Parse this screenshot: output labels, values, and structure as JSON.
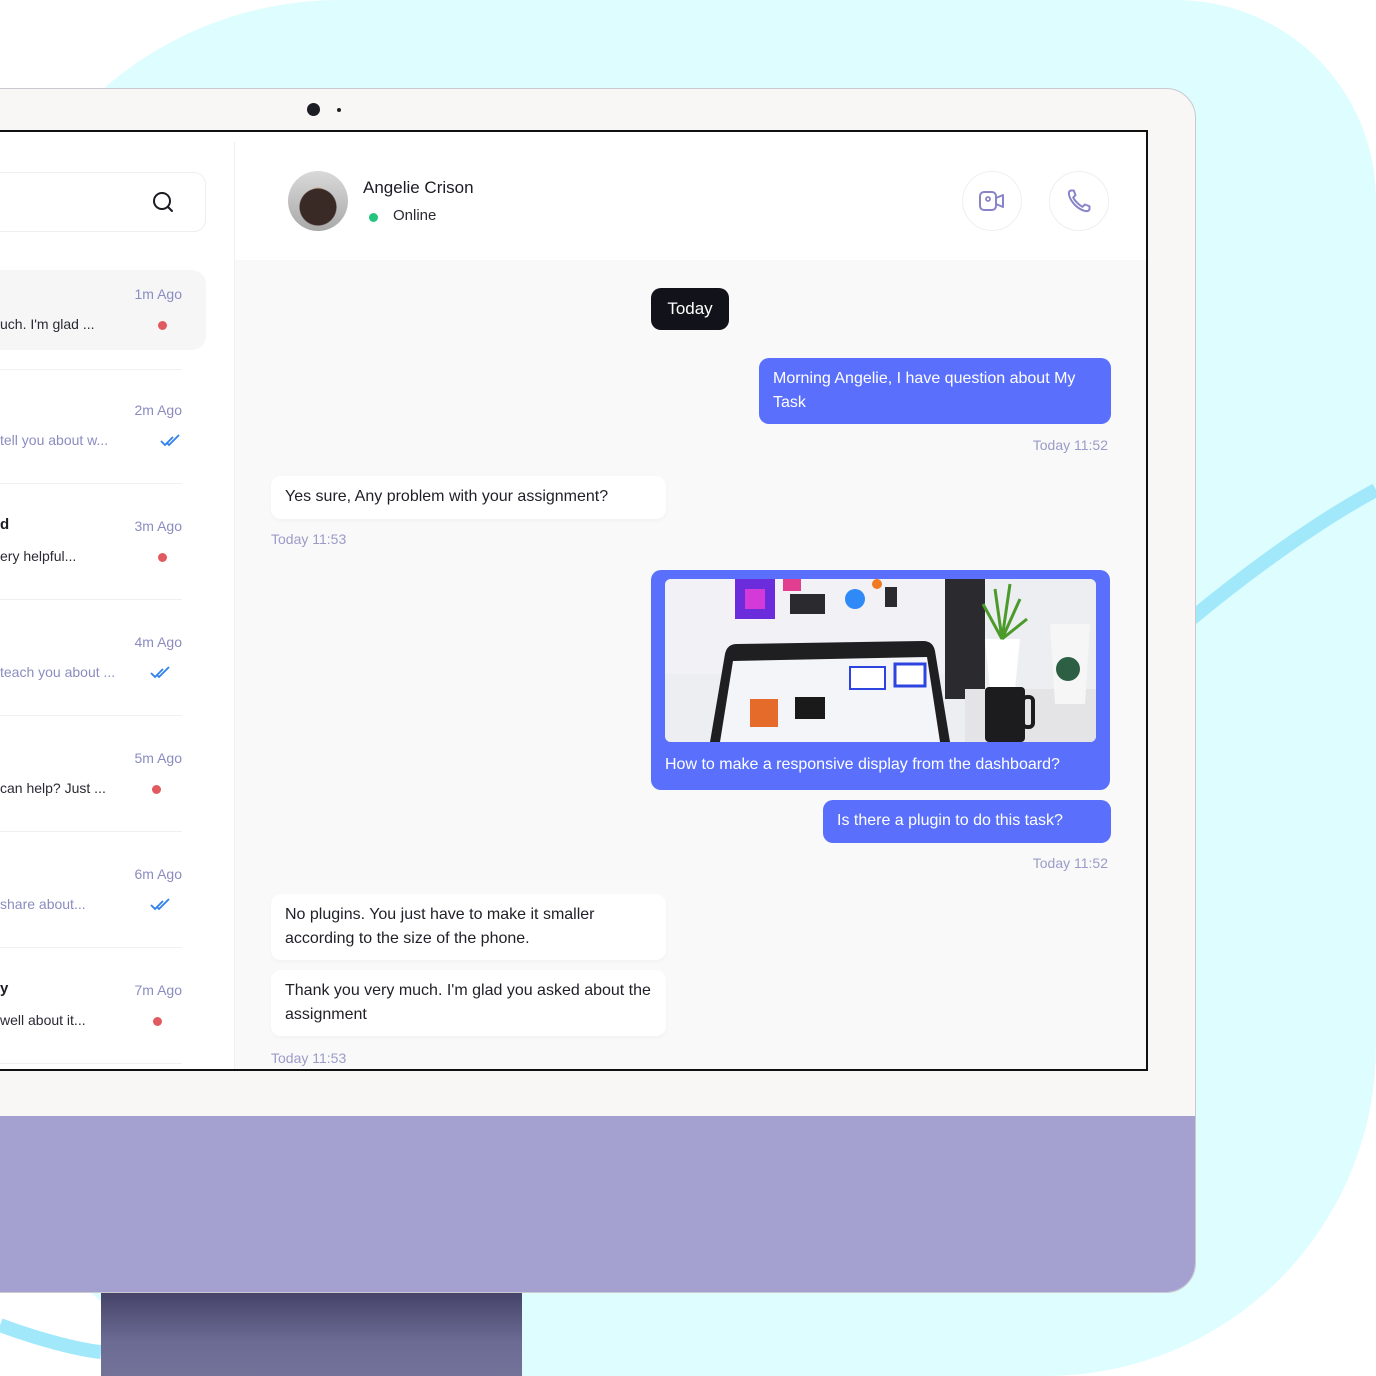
{
  "colors": {
    "accent": "#5a70fd",
    "background_tint": "#defdfe",
    "monitor_chin": "#a4a1d0",
    "online": "#22c47e",
    "unread": "#e05a5f",
    "read_check": "#2f80ed",
    "muted_text": "#8b8cc0"
  },
  "sidebar": {
    "search": {
      "placeholder": "",
      "icon": "search-icon"
    },
    "chats": [
      {
        "name": "",
        "preview": "uch. I'm glad ...",
        "time": "1m Ago",
        "status": "unread",
        "active": true
      },
      {
        "name": "",
        "preview": "tell you about w...",
        "time": "2m Ago",
        "status": "read"
      },
      {
        "name": "d",
        "preview": "ery helpful...",
        "time": "3m Ago",
        "status": "unread"
      },
      {
        "name": "",
        "preview": "teach you about ...",
        "time": "4m Ago",
        "status": "read"
      },
      {
        "name": "",
        "preview": "can help? Just ...",
        "time": "5m Ago",
        "status": "unread"
      },
      {
        "name": "",
        "preview": "share about...",
        "time": "6m Ago",
        "status": "read"
      },
      {
        "name": "y",
        "preview": "well about it...",
        "time": "7m Ago",
        "status": "unread"
      }
    ]
  },
  "header": {
    "contact_name": "Angelie Crison",
    "status": "Online",
    "video_call_icon": "video-camera-icon",
    "voice_call_icon": "phone-icon"
  },
  "conversation": {
    "date_divider": "Today",
    "messages": [
      {
        "direction": "out",
        "text": "Morning Angelie, I have question about My Task",
        "time": "Today 11:52"
      },
      {
        "direction": "in",
        "text": "Yes sure, Any problem with your assignment?",
        "time": "Today 11:53"
      },
      {
        "direction": "out",
        "type": "image",
        "image_alt": "Laptop showing design dashboard on desk with plant and mugs",
        "text": "How to make a responsive display from the dashboard?"
      },
      {
        "direction": "out",
        "text": "Is there a plugin to do this task?",
        "time": "Today 11:52"
      },
      {
        "direction": "in",
        "text": "No plugins. You just have to make it smaller according to the size of the phone."
      },
      {
        "direction": "in",
        "text": "Thank you very much. I'm glad you asked about the assignment",
        "time": "Today 11:53"
      }
    ]
  }
}
